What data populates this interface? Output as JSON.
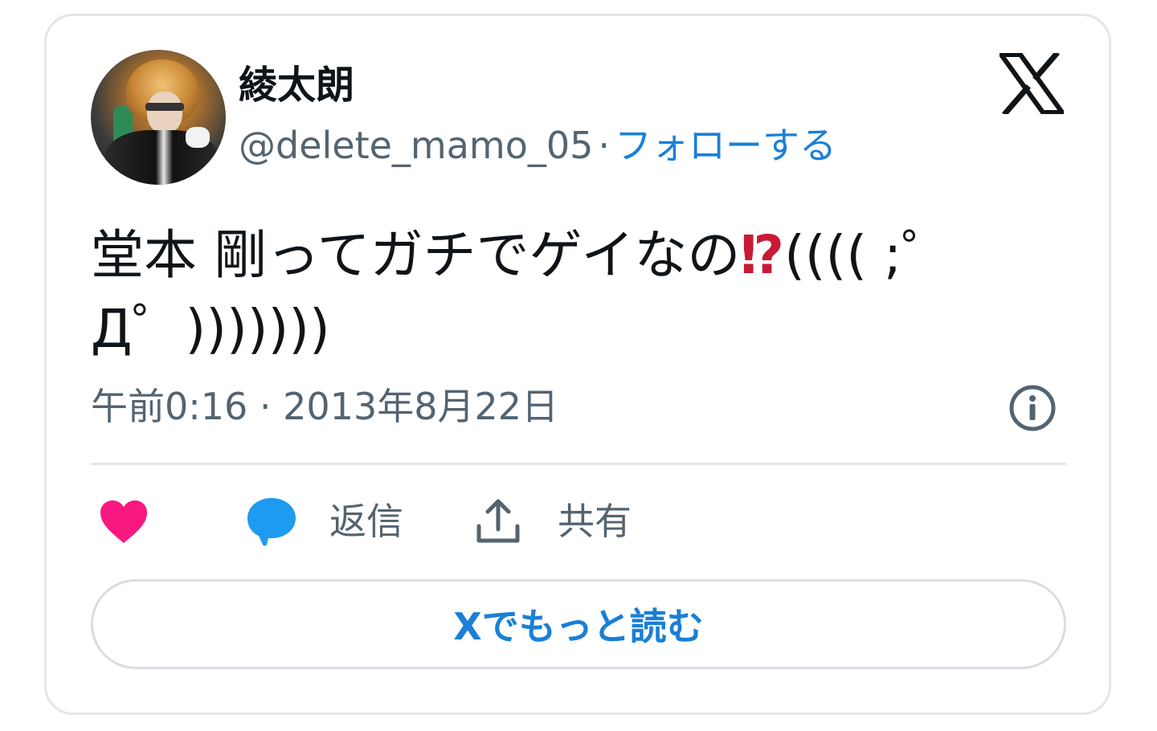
{
  "user": {
    "display_name": "綾太朗",
    "handle": "@delete_mamo_05",
    "separator": "·",
    "follow_label": "フォローする"
  },
  "tweet": {
    "text_main": "堂本 剛ってガチでゲイなの",
    "text_emoji": "⁉",
    "text_tail": "(((( ;゜Д゜)))))))",
    "timestamp": "午前0:16 · 2013年8月22日"
  },
  "actions": {
    "reply_label": "返信",
    "share_label": "共有"
  },
  "read_more_label": "Xでもっと読む",
  "icons": {
    "logo": "x-logo-icon",
    "info": "info-icon",
    "like": "heart-icon",
    "reply": "speech-bubble-icon",
    "share": "upload-share-icon"
  },
  "colors": {
    "like": "#f91880",
    "reply": "#1d9bf0",
    "link": "#1a7fd6",
    "secondary_text": "#536471"
  }
}
